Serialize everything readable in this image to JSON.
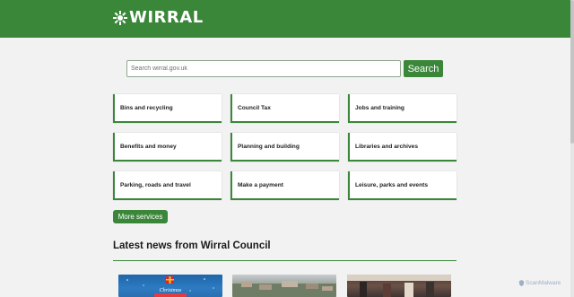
{
  "header": {
    "logo_text": "WIRRAL",
    "color": "#3a873a"
  },
  "search": {
    "placeholder": "Search wirral.gov.uk",
    "button_label": "Search"
  },
  "services": [
    {
      "label": "Bins and recycling"
    },
    {
      "label": "Council Tax"
    },
    {
      "label": "Jobs and training"
    },
    {
      "label": "Benefits and money"
    },
    {
      "label": "Planning and building"
    },
    {
      "label": "Libraries and archives"
    },
    {
      "label": "Parking, roads and travel"
    },
    {
      "label": "Make a payment"
    },
    {
      "label": "Leisure, parks and events"
    }
  ],
  "more_services_label": "More services",
  "news": {
    "heading": "Latest news from Wirral Council",
    "images": [
      {
        "icon": "christmas-image",
        "caption": "Christmas"
      },
      {
        "icon": "aerial-town-image"
      },
      {
        "icon": "people-indoors-image"
      }
    ]
  },
  "watermark": {
    "text": "ScanMalware"
  }
}
